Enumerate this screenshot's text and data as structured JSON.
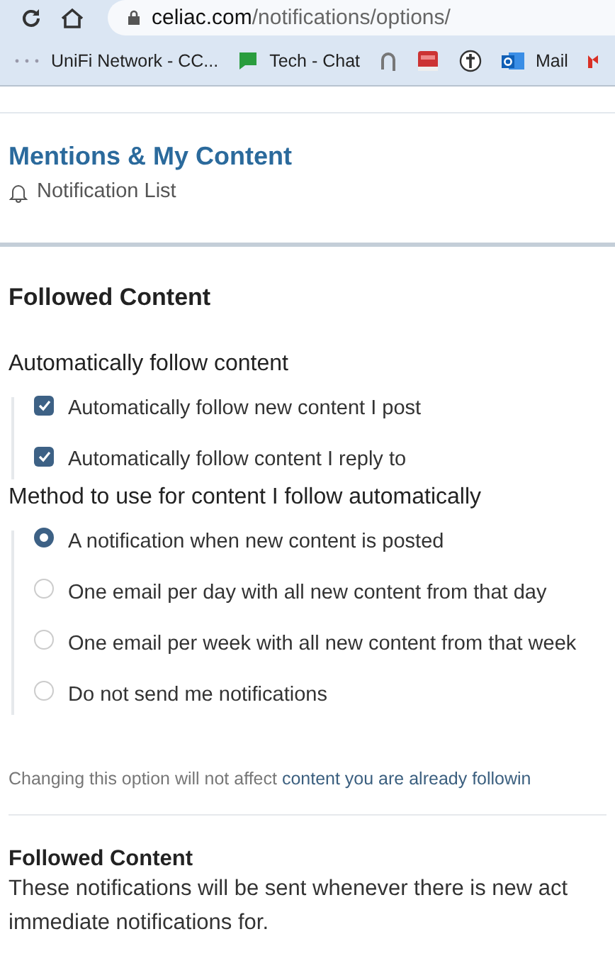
{
  "browser": {
    "url": "celiac.com/notifications/options/",
    "bookmarks": [
      {
        "kind": "dots",
        "label": "UniFi Network - CC..."
      },
      {
        "kind": "chat",
        "label": "Tech - Chat"
      },
      {
        "kind": "arc"
      },
      {
        "kind": "book"
      },
      {
        "kind": "cross"
      },
      {
        "kind": "outlook",
        "label": "Mail"
      },
      {
        "kind": "gmail"
      }
    ]
  },
  "section": {
    "title": "Mentions & My Content",
    "link": "Notification List"
  },
  "panel": {
    "title": "Followed Content",
    "groups": [
      {
        "label": "Automatically follow content",
        "options": [
          {
            "kind": "checkbox",
            "label": "Automatically follow new content I post",
            "checked": true
          },
          {
            "kind": "checkbox",
            "label": "Automatically follow content I reply to",
            "checked": true
          }
        ]
      },
      {
        "label": "Method to use for content I follow automatically",
        "options": [
          {
            "kind": "radio",
            "label": "A notification when new content is posted",
            "selected": true
          },
          {
            "kind": "radio",
            "label": "One email per day with all new content from that day",
            "selected": false
          },
          {
            "kind": "radio",
            "label": "One email per week with all new content from that week",
            "selected": false
          },
          {
            "kind": "radio",
            "label": "Do not send me notifications",
            "selected": false
          }
        ]
      }
    ],
    "hint": {
      "text": "Changing this option will not affect ",
      "link": "content you are already followin"
    },
    "footer": {
      "title": "Followed Content",
      "lines": [
        "These notifications will be sent whenever there is new act",
        "immediate notifications for."
      ]
    }
  }
}
